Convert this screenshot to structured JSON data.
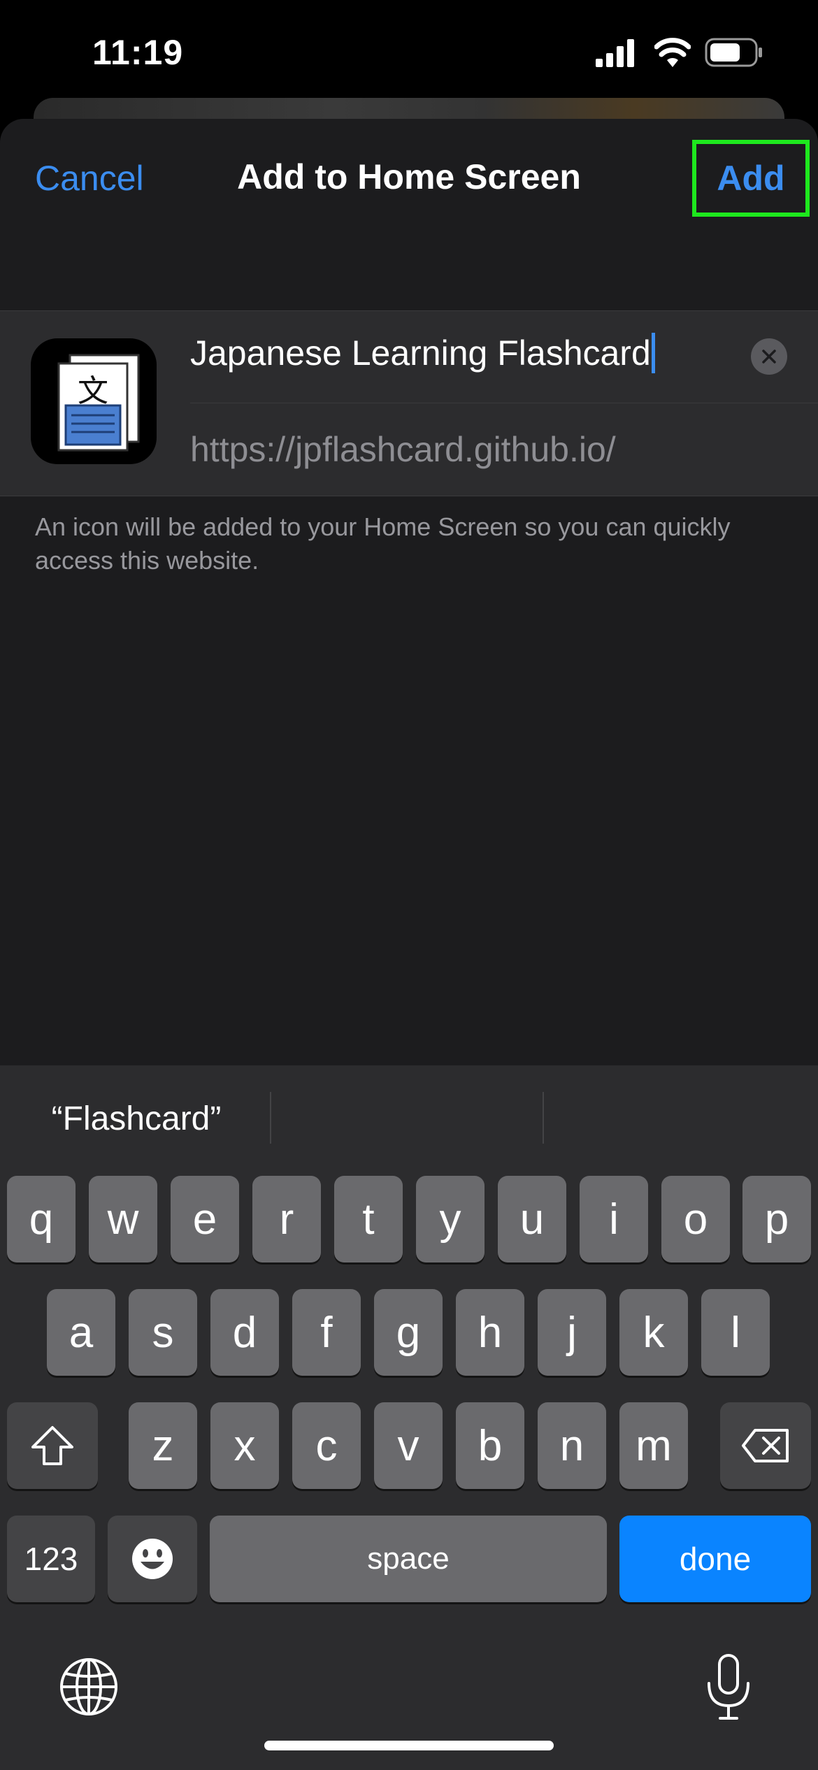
{
  "status_bar": {
    "time": "11:19"
  },
  "nav": {
    "cancel": "Cancel",
    "title": "Add to Home Screen",
    "add": "Add"
  },
  "form": {
    "name_value": "Japanese Learning Flashcard",
    "url": "https://jpflashcard.github.io/",
    "icon_glyph": "文"
  },
  "helper_text": "An icon will be added to your Home Screen so you can quickly access this website.",
  "keyboard": {
    "suggestions": [
      "“Flashcard”",
      "",
      ""
    ],
    "row1": [
      "q",
      "w",
      "e",
      "r",
      "t",
      "y",
      "u",
      "i",
      "o",
      "p"
    ],
    "row2": [
      "a",
      "s",
      "d",
      "f",
      "g",
      "h",
      "j",
      "k",
      "l"
    ],
    "row3": [
      "z",
      "x",
      "c",
      "v",
      "b",
      "n",
      "m"
    ],
    "numbers_label": "123",
    "space_label": "space",
    "done_label": "done"
  },
  "colors": {
    "accent": "#3b8df0",
    "done_key": "#0a84ff",
    "highlight_box": "#1ee81e"
  }
}
